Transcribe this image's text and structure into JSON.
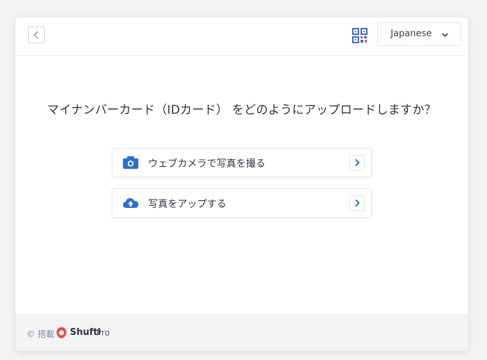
{
  "header": {
    "language": "Japanese"
  },
  "main": {
    "question": "マイナンバーカード（IDカード） をどのようにアップロードしますか？",
    "options": [
      {
        "label": "ウェブカメラで写真を撮る",
        "icon": "camera-icon"
      },
      {
        "label": "写真をアップする",
        "icon": "cloud-upload-icon"
      }
    ]
  },
  "footer": {
    "powered_by": "© 搭載",
    "brand": "Shufti",
    "brand_suffix": "Pro"
  },
  "colors": {
    "accent": "#2d6fd2",
    "brand_red": "#e84c3d",
    "text": "#2f333d"
  }
}
